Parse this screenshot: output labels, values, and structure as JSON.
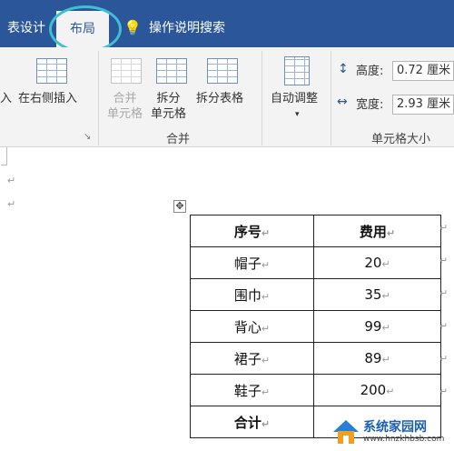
{
  "tabs": {
    "table_design": "表设计",
    "layout": "布局",
    "tell_me": "操作说明搜索"
  },
  "ribbon": {
    "insert_left_partial": "入",
    "insert_right": "在右侧插入",
    "merge_cells": [
      "合并",
      "单元格"
    ],
    "split_cells": [
      "拆分",
      "单元格"
    ],
    "split_table": "拆分表格",
    "group_merge": "合并",
    "autofit": "自动调整",
    "height_label": "高度:",
    "height_value": "0.72 厘米",
    "width_label": "宽度:",
    "width_value": "2.93 厘米",
    "group_cell_size": "单元格大小"
  },
  "table": {
    "rows": [
      {
        "item": "序号",
        "cost": "费用"
      },
      {
        "item": "帽子",
        "cost": "20"
      },
      {
        "item": "围巾",
        "cost": "35"
      },
      {
        "item": "背心",
        "cost": "99"
      },
      {
        "item": "裙子",
        "cost": "89"
      },
      {
        "item": "鞋子",
        "cost": "200"
      },
      {
        "item": "合计",
        "cost": ""
      }
    ]
  },
  "watermark": {
    "title": "系统家园网",
    "url": "www.hnzkhbsb.com"
  },
  "colors": {
    "ribbon_tab_bar": "#2b579a",
    "highlight_circle": "#3fbfd2"
  }
}
